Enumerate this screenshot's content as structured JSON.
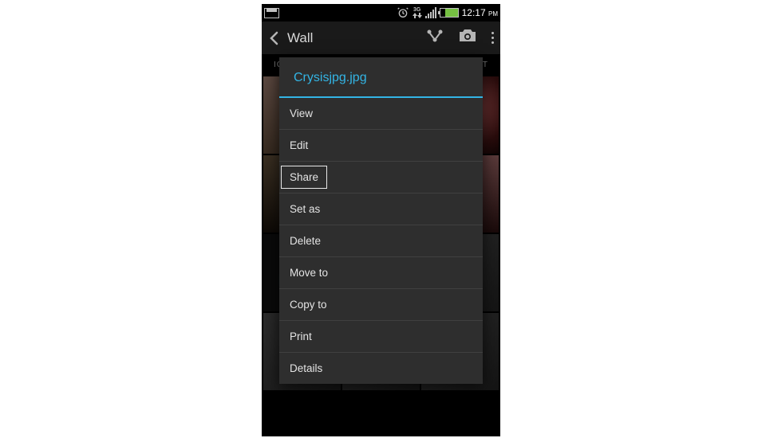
{
  "status": {
    "time": "12:17",
    "ampm": "PM"
  },
  "app_bar": {
    "title": "Wall"
  },
  "tabs": {
    "left_partial": "IG",
    "right_partial": "DAT"
  },
  "dialog": {
    "title": "Crysisjpg.jpg",
    "items": [
      {
        "label": "View",
        "highlighted": false
      },
      {
        "label": "Edit",
        "highlighted": false
      },
      {
        "label": "Share",
        "highlighted": true
      },
      {
        "label": "Set as",
        "highlighted": false
      },
      {
        "label": "Delete",
        "highlighted": false
      },
      {
        "label": "Move to",
        "highlighted": false
      },
      {
        "label": "Copy to",
        "highlighted": false
      },
      {
        "label": "Print",
        "highlighted": false
      },
      {
        "label": "Details",
        "highlighted": false
      }
    ]
  }
}
